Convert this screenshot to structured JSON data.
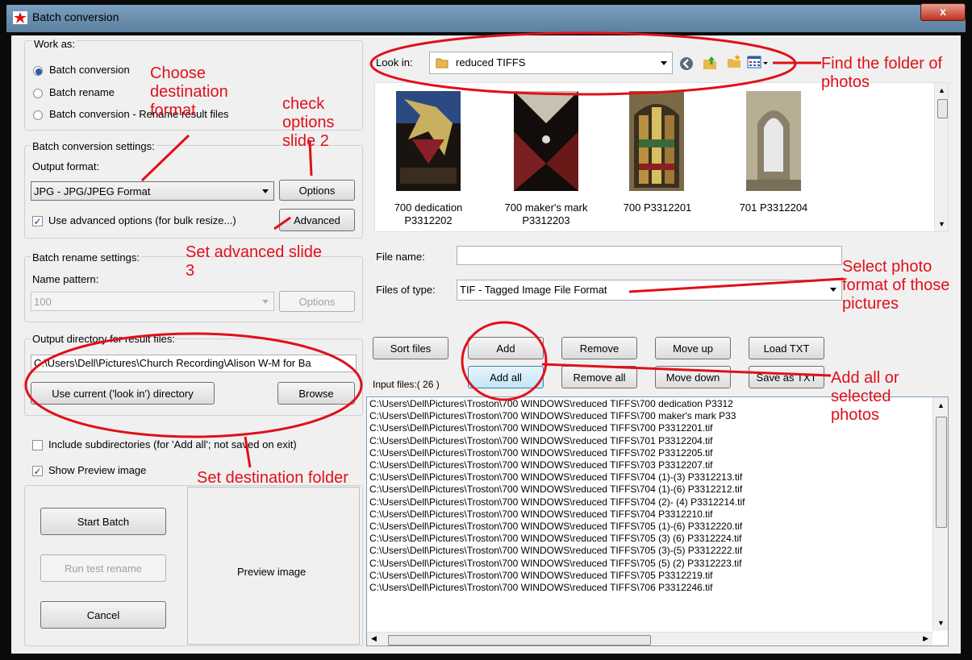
{
  "window": {
    "title": "Batch conversion",
    "close_glyph": "x"
  },
  "work_as": {
    "label": "Work as:",
    "options": [
      "Batch conversion",
      "Batch rename",
      "Batch conversion - Rename result files"
    ],
    "selected": 0
  },
  "conversion": {
    "label": "Batch conversion settings:",
    "output_format_label": "Output format:",
    "output_format": "JPG - JPG/JPEG Format",
    "options_btn": "Options",
    "advanced_chk": "Use advanced options (for bulk resize...)",
    "advanced_btn": "Advanced"
  },
  "rename": {
    "label": "Batch rename settings:",
    "pattern_label": "Name pattern:",
    "pattern": "100",
    "options_btn": "Options"
  },
  "output": {
    "label": "Output directory for result files:",
    "path": "C:\\Users\\Dell\\Pictures\\Church Recording\\Alison W-M for Ba",
    "use_current_btn": "Use current ('look in') directory",
    "browse_btn": "Browse"
  },
  "include_subdirs": "Include subdirectories (for 'Add all'; not saved on exit)",
  "show_preview": "Show Preview image",
  "start_batch": "Start Batch",
  "run_test": "Run test rename",
  "cancel": "Cancel",
  "preview_label": "Preview image",
  "look_in": {
    "label": "Look in:",
    "folder": "reduced TIFFS"
  },
  "thumbnails": [
    {
      "label": "700 dedication P3312202"
    },
    {
      "label": "700 maker's mark P3312203"
    },
    {
      "label": "700 P3312201"
    },
    {
      "label": "701 P3312204"
    }
  ],
  "file_name_label": "File name:",
  "file_name_value": "",
  "files_of_type_label": "Files of type:",
  "files_of_type": "TIF - Tagged Image File Format",
  "buttons": {
    "sort": "Sort files",
    "add": "Add",
    "remove": "Remove",
    "move_up": "Move up",
    "load_txt": "Load TXT",
    "add_all": "Add all",
    "remove_all": "Remove all",
    "move_down": "Move down",
    "save_txt": "Save as TXT"
  },
  "input_files_label": "Input files:( 26 )",
  "files": [
    "C:\\Users\\Dell\\Pictures\\Troston\\700 WINDOWS\\reduced TIFFS\\700 dedication P3312",
    "C:\\Users\\Dell\\Pictures\\Troston\\700 WINDOWS\\reduced TIFFS\\700 maker's mark P33",
    "C:\\Users\\Dell\\Pictures\\Troston\\700 WINDOWS\\reduced TIFFS\\700 P3312201.tif",
    "C:\\Users\\Dell\\Pictures\\Troston\\700 WINDOWS\\reduced TIFFS\\701 P3312204.tif",
    "C:\\Users\\Dell\\Pictures\\Troston\\700 WINDOWS\\reduced TIFFS\\702 P3312205.tif",
    "C:\\Users\\Dell\\Pictures\\Troston\\700 WINDOWS\\reduced TIFFS\\703 P3312207.tif",
    "C:\\Users\\Dell\\Pictures\\Troston\\700 WINDOWS\\reduced TIFFS\\704 (1)-(3) P3312213.tif",
    "C:\\Users\\Dell\\Pictures\\Troston\\700 WINDOWS\\reduced TIFFS\\704 (1)-(6) P3312212.tif",
    "C:\\Users\\Dell\\Pictures\\Troston\\700 WINDOWS\\reduced TIFFS\\704 (2)- (4) P3312214.tif",
    "C:\\Users\\Dell\\Pictures\\Troston\\700 WINDOWS\\reduced TIFFS\\704 P3312210.tif",
    "C:\\Users\\Dell\\Pictures\\Troston\\700 WINDOWS\\reduced TIFFS\\705 (1)-(6) P3312220.tif",
    "C:\\Users\\Dell\\Pictures\\Troston\\700 WINDOWS\\reduced TIFFS\\705 (3) (6) P3312224.tif",
    "C:\\Users\\Dell\\Pictures\\Troston\\700 WINDOWS\\reduced TIFFS\\705 (3)-(5) P3312222.tif",
    "C:\\Users\\Dell\\Pictures\\Troston\\700 WINDOWS\\reduced TIFFS\\705 (5) (2) P3312223.tif",
    "C:\\Users\\Dell\\Pictures\\Troston\\700 WINDOWS\\reduced TIFFS\\705 P3312219.tif",
    "C:\\Users\\Dell\\Pictures\\Troston\\700 WINDOWS\\reduced TIFFS\\706 P3312246.tif"
  ],
  "annotations": {
    "choose": "Choose destination format",
    "check": "check options slide 2",
    "advanced": "Set advanced slide 3",
    "dest": "Set destination folder",
    "find": "Find the folder of photos",
    "select": "Select photo format of those pictures",
    "addall": "Add all or selected photos"
  },
  "colors": {
    "annotation": "#e0101a",
    "title_gradient": "#7a9fbf",
    "close_button": "#c03020"
  }
}
